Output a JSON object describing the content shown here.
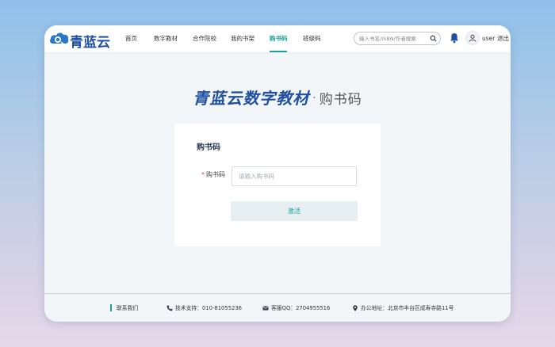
{
  "brand": {
    "name": "青蓝云"
  },
  "nav": {
    "items": [
      {
        "label": "首页"
      },
      {
        "label": "数字教材"
      },
      {
        "label": "合作院校"
      },
      {
        "label": "我的书架"
      },
      {
        "label": "购书码"
      },
      {
        "label": "班级码"
      }
    ],
    "active": "购书码"
  },
  "search": {
    "placeholder": "输入书名/ISBN/作者搜索"
  },
  "user": {
    "name": "user",
    "logout_label": "退出"
  },
  "page": {
    "title_main": "青蓝云数字教材",
    "title_separator": "·",
    "title_sub": "购书码"
  },
  "form": {
    "title": "购书码",
    "required_mark": "*",
    "code_label": "购书码",
    "code_placeholder": "请输入购书码",
    "code_value": "",
    "submit_label": "激活"
  },
  "footer": {
    "contact_label": "联系我们",
    "support": "技术支持：010-81055236",
    "qq": "客服QQ：2704955516",
    "address": "办公地址：北京市丰台区成寿寺路11号"
  },
  "colors": {
    "accent": "#1aa19a",
    "brand": "#1f4fa0",
    "required": "#e0454a"
  }
}
